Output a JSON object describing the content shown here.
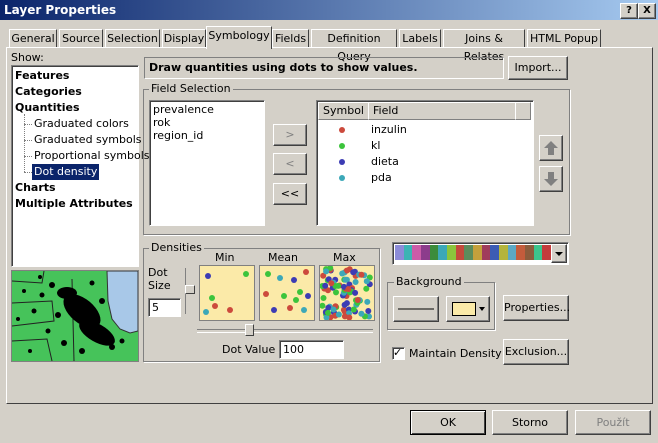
{
  "window": {
    "title": "Layer Properties",
    "help_btn": "?",
    "close_btn": "X"
  },
  "tabs": [
    {
      "label": "General"
    },
    {
      "label": "Source"
    },
    {
      "label": "Selection"
    },
    {
      "label": "Display"
    },
    {
      "label": "Symbology"
    },
    {
      "label": "Fields"
    },
    {
      "label": "Definition Query"
    },
    {
      "label": "Labels"
    },
    {
      "label": "Joins & Relates"
    },
    {
      "label": "HTML Popup"
    }
  ],
  "show": {
    "label": "Show:",
    "items": [
      "Features",
      "Categories",
      "Quantities",
      "Graduated colors",
      "Graduated symbols",
      "Proportional symbols",
      "Dot density",
      "Charts",
      "Multiple Attributes"
    ]
  },
  "description": "Draw quantities using dots to show values.",
  "import_label": "Import...",
  "field_selection": {
    "label": "Field Selection",
    "available": [
      "prevalence",
      "rok",
      "region_id"
    ],
    "add_btn": ">",
    "remove_btn": "<",
    "remove_all_btn": "<<",
    "col_symbol": "Symbol",
    "col_field": "Field",
    "selected": [
      {
        "field": "inzulin",
        "color": "#cc4a3c"
      },
      {
        "field": "kl",
        "color": "#3cc43c"
      },
      {
        "field": "dieta",
        "color": "#3c3cb4"
      },
      {
        "field": "pda",
        "color": "#3ca8b8"
      }
    ]
  },
  "densities": {
    "label": "Densities",
    "min_label": "Min",
    "mean_label": "Mean",
    "max_label": "Max",
    "dot_size_label": "Dot Size",
    "dot_size_value": "5",
    "dot_value_label": "Dot Value",
    "dot_value": "100"
  },
  "color_ramp": [
    "#8c8cd8",
    "#3cb4b4",
    "#cc5ca8",
    "#8c3c8c",
    "#3c8c3c",
    "#3ca8b8",
    "#8cc43c",
    "#c44a3c",
    "#5c8c5c",
    "#c4a03c",
    "#a03c5c",
    "#3c5cb4",
    "#b4b43c",
    "#5ca8c4",
    "#c45c3c",
    "#8c5c3c",
    "#3cc48c",
    "#c43c3c"
  ],
  "background": {
    "label": "Background",
    "fill_color": "#fbeaa8"
  },
  "properties_label": "Properties...",
  "maintain_density": {
    "label": "Maintain Density",
    "checked": "✓"
  },
  "exclusion_label": "Exclusion...",
  "footer": {
    "ok": "OK",
    "cancel": "Storno",
    "apply": "Použít"
  }
}
